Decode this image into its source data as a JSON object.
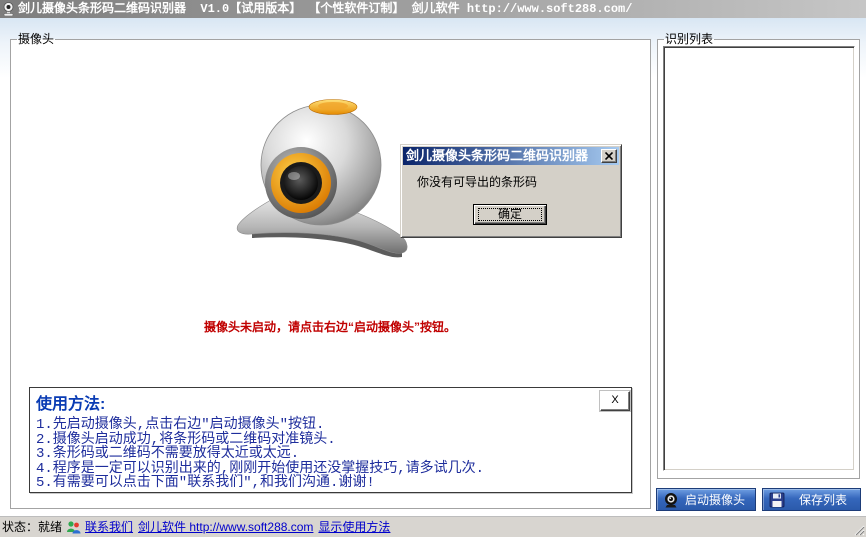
{
  "window": {
    "title": "剑儿摄像头条形码二维码识别器  V1.0【试用版本】 【个性软件订制】 剑儿软件 http://www.soft288.com/"
  },
  "camera_group": {
    "label": "摄像头",
    "status_message": "摄像头未启动，请点击右边“启动摄像头”按钮。"
  },
  "usage_panel": {
    "title": "使用方法:",
    "close_label": "X",
    "lines": [
      "1.先启动摄像头,点击右边\"启动摄像头\"按钮.",
      "2.摄像头启动成功,将条形码或二维码对准镜头.",
      "3.条形码或二维码不需要放得太近或太远.",
      "4.程序是一定可以识别出来的,刚刚开始使用还没掌握技巧,请多试几次.",
      "5.有需要可以点击下面\"联系我们\",和我们沟通.谢谢!"
    ]
  },
  "list_group": {
    "label": "识别列表"
  },
  "buttons": {
    "start_camera": "启动摄像头",
    "save_list": "保存列表"
  },
  "dialog": {
    "title": "剑儿摄像头条形码二维码识别器",
    "message": "你没有可导出的条形码",
    "ok_label": "确定"
  },
  "status_bar": {
    "status": "状态：就绪",
    "contact_link": "联系我们",
    "website_link": "剑儿软件 http://www.soft288.com",
    "show_usage_link": "显示使用方法"
  },
  "icons": {
    "app": "app-camera-icon",
    "camera_illustration": "webcam-illustration",
    "start_camera": "webcam-icon",
    "save_list": "floppy-disk-icon",
    "contact": "contact-people-icon",
    "dialog_close": "close-icon",
    "resize": "resize-grip-icon"
  },
  "colors": {
    "titlebar_start": "#7D7D7D",
    "titlebar_end": "#C6C6C6",
    "status_message": "#C00000",
    "usage_title": "#0A3CB4",
    "usage_text": "#1E2D9C",
    "link": "#0000CC",
    "button_blue": "#3567BC",
    "dialog_titlebar": "#0A246A",
    "dialog_face": "#D4D0C8"
  }
}
